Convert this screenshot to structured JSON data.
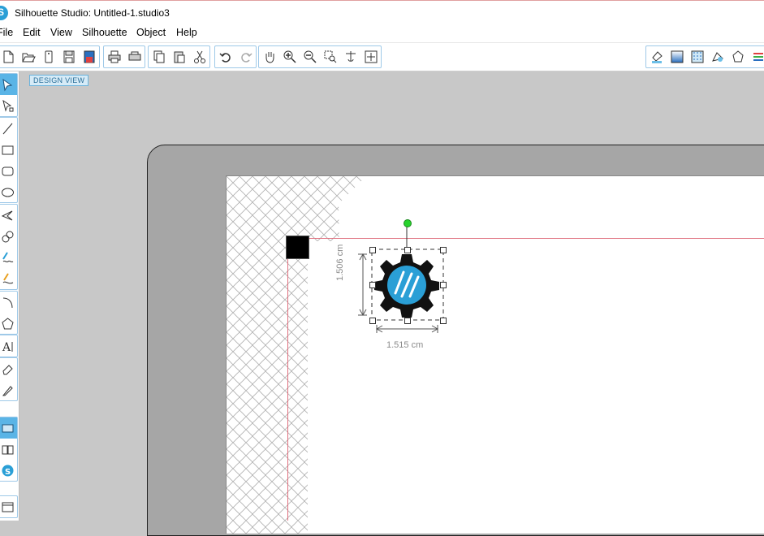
{
  "window": {
    "title": "Silhouette Studio: Untitled-1.studio3"
  },
  "menu": [
    "File",
    "Edit",
    "View",
    "Silhouette",
    "Object",
    "Help"
  ],
  "toolbar": {
    "groups": [
      [
        "new-file-icon",
        "open-file-icon",
        "open-library-icon",
        "save-icon",
        "save-to-library-icon"
      ],
      [
        "print-icon",
        "print-cut-icon"
      ],
      [
        "copy-icon",
        "paste-icon",
        "cut-icon"
      ],
      [
        "undo-icon",
        "redo-icon"
      ],
      [
        "pan-icon",
        "zoom-in-icon",
        "zoom-out-icon",
        "zoom-box-icon",
        "zoom-drag-icon",
        "zoom-fit-icon"
      ]
    ],
    "right_group": [
      "fill-color-icon",
      "gradient-icon",
      "fill-pattern-icon",
      "line-color-icon",
      "line-style-icon",
      "more-icon"
    ]
  },
  "left_tools": {
    "groups": [
      [
        "select-icon",
        "point-edit-icon"
      ],
      [
        "line-icon",
        "rectangle-icon",
        "rounded-rectangle-icon",
        "ellipse-icon"
      ],
      [
        "polygon-icon",
        "curve-icon",
        "freehand-icon",
        "smooth-freehand-icon"
      ],
      [
        "arc-icon",
        "regular-polygon-icon"
      ],
      [
        "text-icon"
      ],
      [
        "eraser-icon",
        "knife-icon"
      ],
      [
        "design-page-icon",
        "library-icon",
        "store-icon"
      ],
      [
        "window-icon"
      ]
    ]
  },
  "design_view_label": "DESIGN VIEW",
  "selection": {
    "height_label": "1.506 cm",
    "width_label": "1.515 cm"
  },
  "colors": {
    "accent": "#2a9fd6",
    "cut_line": "#e0707e",
    "rotate_handle": "#27d32c",
    "mat": "#a6a6a6"
  }
}
